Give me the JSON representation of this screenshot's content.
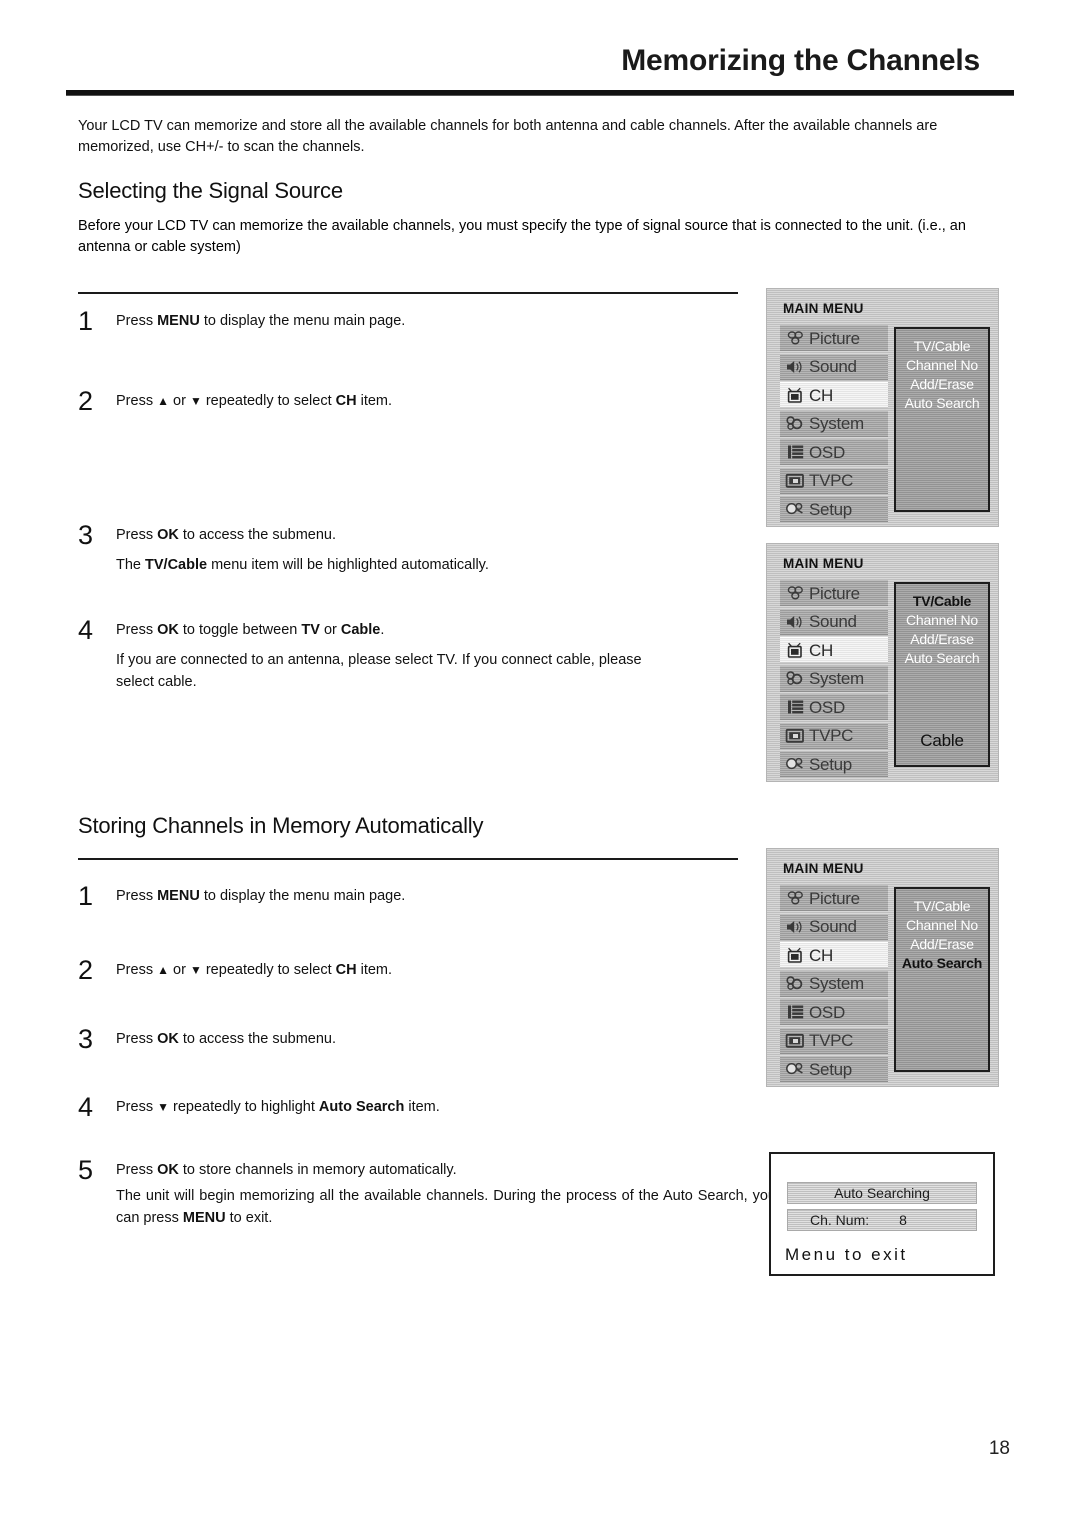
{
  "page": {
    "title": "Memorizing the Channels",
    "number": "18",
    "intro": "Your LCD TV can memorize and store all the available channels for both antenna and cable channels. After the  available channels are memorized, use CH+/- to scan the channels."
  },
  "section1": {
    "heading": "Selecting the Signal Source",
    "intro": "Before your LCD TV can memorize the available channels, you must specify the type of signal  source that is connected to the unit. (i.e., an antenna or cable system)",
    "steps": [
      {
        "num": "1",
        "body_pre": "Press  ",
        "body_bold": "MENU",
        "body_post": " to display the menu main page."
      },
      {
        "num": "2",
        "body_pre": "Press ",
        "arrow_up": "▲",
        "mid": " or ",
        "arrow_down": "▼",
        "body_mid2": " repeatedly to select ",
        "body_bold": "CH",
        "body_post": " item."
      },
      {
        "num": "3",
        "body_pre": "Press ",
        "body_bold": "OK",
        "body_post": " to access the submenu.",
        "sub_pre": "The ",
        "sub_bold": "TV/Cable",
        "sub_post": " menu item will be highlighted automatically."
      },
      {
        "num": "4",
        "body_pre": "Press ",
        "body_bold": "OK",
        "body_mid": " to toggle between ",
        "body_bold2": "TV",
        "body_mid2": " or ",
        "body_bold3": "Cable",
        "body_post": ".",
        "sub": "If you are connected to an antenna, please select TV. If you connect cable, please select cable."
      }
    ]
  },
  "section2": {
    "heading": "Storing Channels in Memory Automatically",
    "steps": [
      {
        "num": "1",
        "body_pre": "Press  ",
        "body_bold": "MENU",
        "body_post": " to display the menu main page."
      },
      {
        "num": "2",
        "body_pre": "Press ",
        "arrow_up": "▲",
        "mid": "  or ",
        "arrow_down": "▼",
        "body_mid2": " repeatedly to select ",
        "body_bold": "CH",
        "body_post": " item."
      },
      {
        "num": "3",
        "body_pre": "Press ",
        "body_bold": "OK",
        "body_post": " to access the submenu."
      },
      {
        "num": "4",
        "body_pre": "Press ",
        "arrow_down": "▼",
        "body_mid2": " repeatedly to highlight ",
        "body_bold": "Auto Search",
        "body_post": " item."
      },
      {
        "num": "5",
        "body_pre": "Press ",
        "body_bold": "OK",
        "body_post": " to store channels in memory automatically.",
        "sub_pre": "The unit will begin memorizing all the available channels. During the process of the Auto Search, you can press ",
        "sub_bold": "MENU",
        "sub_post": " to exit."
      }
    ]
  },
  "osd": {
    "title": "MAIN MENU",
    "items": [
      {
        "label": "Picture",
        "icon": "picture-icon"
      },
      {
        "label": "Sound",
        "icon": "speaker-icon"
      },
      {
        "label": "CH",
        "icon": "tv-icon"
      },
      {
        "label": "System",
        "icon": "gears-icon"
      },
      {
        "label": "OSD",
        "icon": "list-icon"
      },
      {
        "label": "TVPC",
        "icon": "monitor-icon"
      },
      {
        "label": "Setup",
        "icon": "tools-icon"
      }
    ],
    "selected_item": "CH",
    "submenu": [
      "TV/Cable",
      "Channel No",
      "Add/Erase",
      "Auto Search"
    ],
    "panel1": {
      "highlight": "",
      "value": ""
    },
    "panel2": {
      "highlight": "TV/Cable",
      "value": "Cable"
    },
    "panel3": {
      "highlight": "Auto Search",
      "value": ""
    }
  },
  "search_dialog": {
    "status": "Auto Searching",
    "channel_label": "Ch. Num:",
    "channel_value": "8",
    "exit_hint": "Menu to exit"
  },
  "colors": {
    "panel_bg": "#c9c9c9",
    "item_bg": "#a6a6a6",
    "submenu_bg": "#9e9e9e",
    "selected_bg": "#ececec",
    "rule": "#111111"
  }
}
